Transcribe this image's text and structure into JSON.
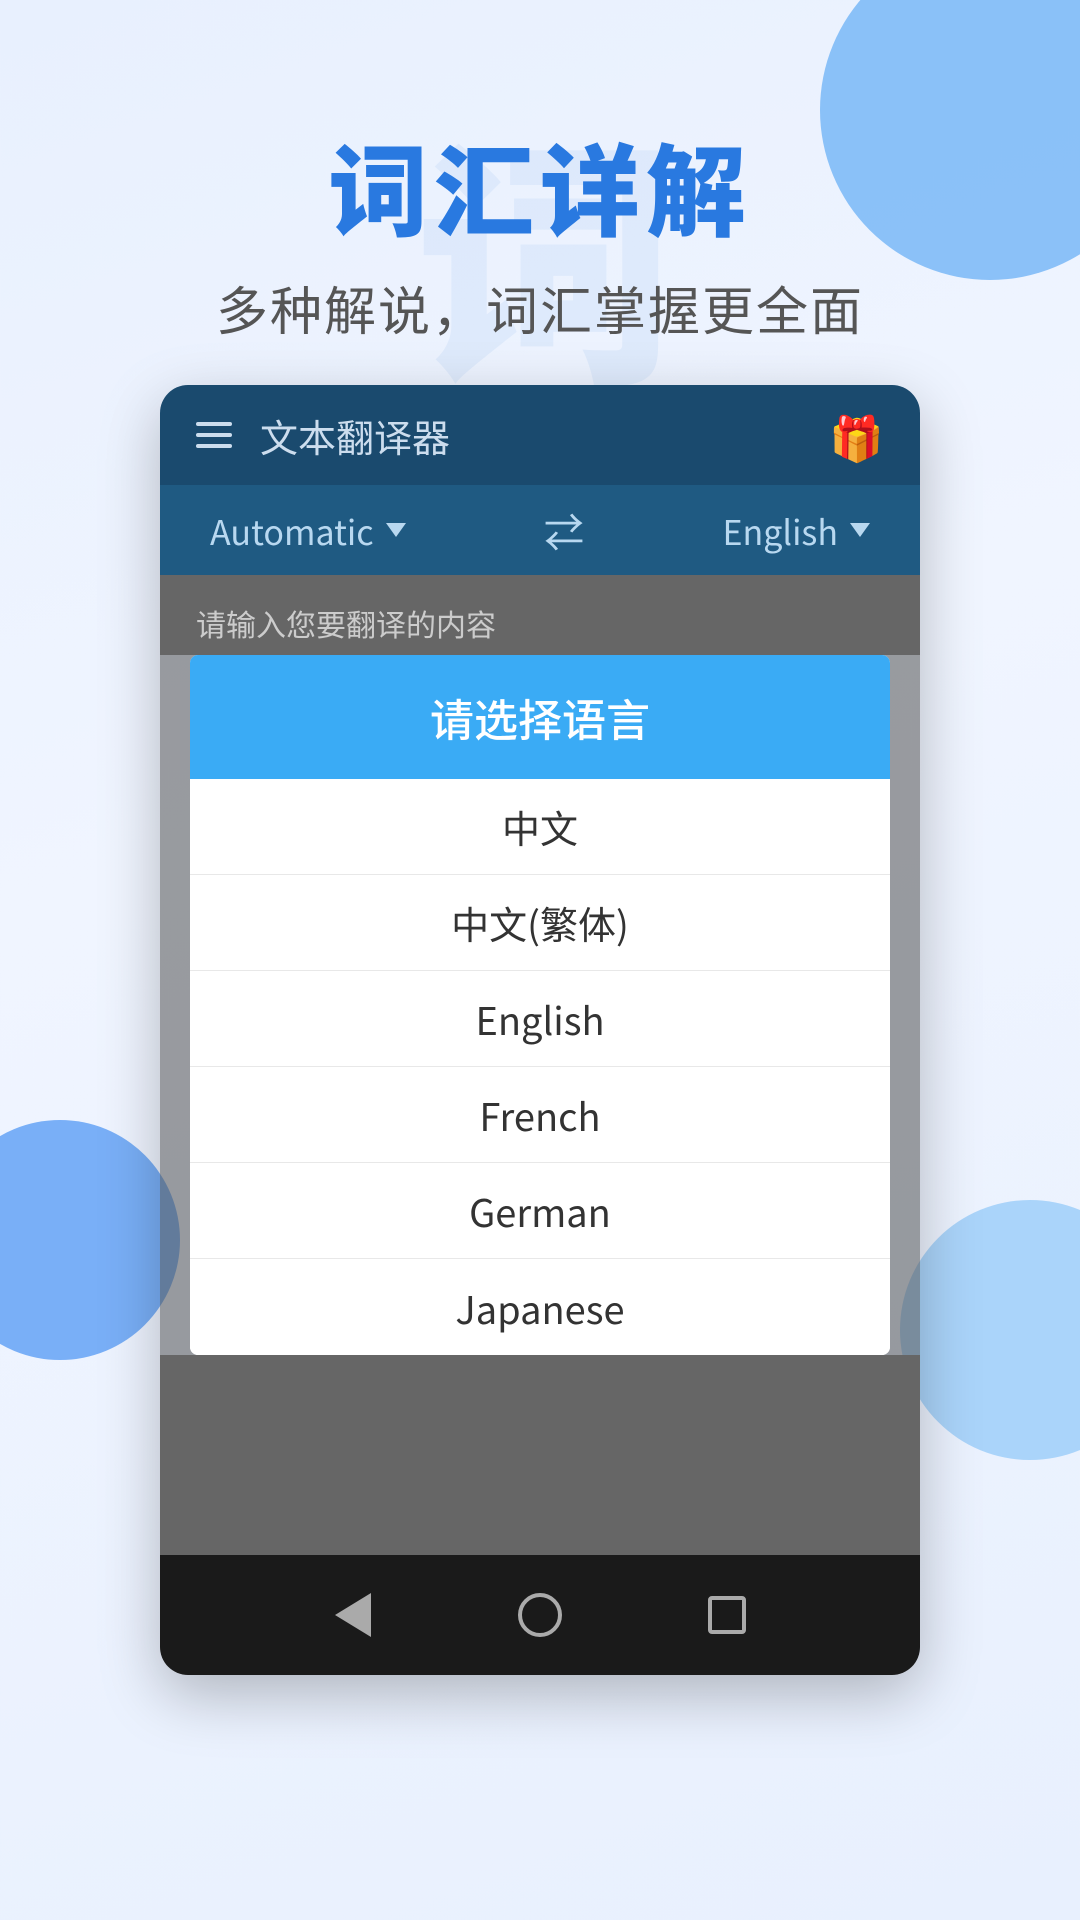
{
  "background": {
    "watermark": "词",
    "color": "#e8f0fe"
  },
  "header": {
    "main_title": "词汇详解",
    "sub_title": "多种解说，词汇掌握更全面"
  },
  "app": {
    "toolbar": {
      "title": "文本翻译器",
      "gift_icon": "🎁"
    },
    "lang_bar": {
      "source_lang": "Automatic",
      "target_lang": "English",
      "swap_icon": "⇄"
    },
    "input_placeholder": "请输入您要翻译的内容"
  },
  "dialog": {
    "title": "请选择语言",
    "items": [
      {
        "id": "zh",
        "label": "中文"
      },
      {
        "id": "zh-tw",
        "label": "中文(繁体)"
      },
      {
        "id": "en",
        "label": "English"
      },
      {
        "id": "fr",
        "label": "French"
      },
      {
        "id": "de",
        "label": "German"
      },
      {
        "id": "ja",
        "label": "Japanese"
      }
    ]
  },
  "navbar": {
    "back_label": "back",
    "home_label": "home",
    "recents_label": "recents"
  }
}
